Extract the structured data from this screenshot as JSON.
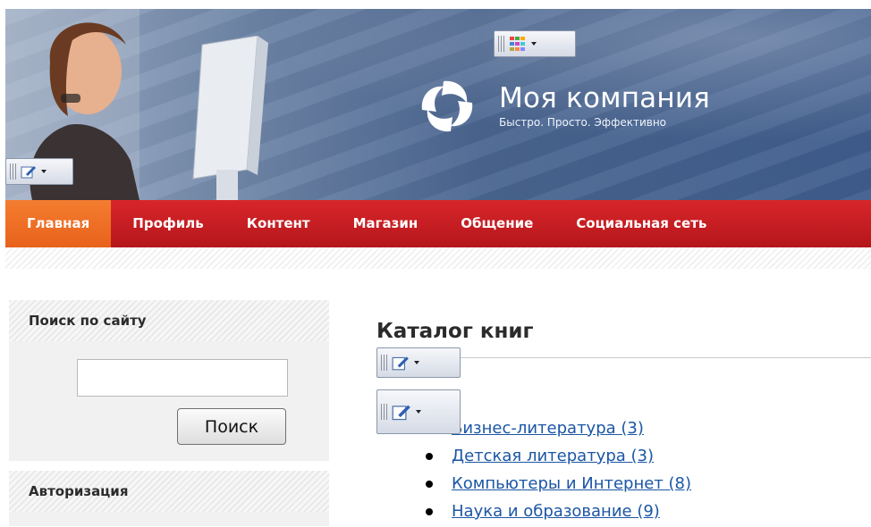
{
  "header": {
    "company_name": "Моя компания",
    "slogan": "Быстро. Просто. Эффективно"
  },
  "nav": {
    "items": [
      "Главная",
      "Профиль",
      "Контент",
      "Магазин",
      "Общение",
      "Социальная сеть"
    ],
    "active_index": 0
  },
  "sidebar": {
    "search_title": "Поиск по сайту",
    "search_input_value": "",
    "search_button": "Поиск",
    "auth_title": "Авторизация"
  },
  "main": {
    "title": "Каталог книг",
    "categories": [
      {
        "label": "Бизнес-литература (3)"
      },
      {
        "label": "Детская литература (3)"
      },
      {
        "label": "Компьютеры и Интернет (8)"
      },
      {
        "label": "Наука и образование (9)"
      }
    ]
  },
  "colors": {
    "nav_red": "#c91d22",
    "nav_active_orange": "#f07028",
    "link_blue": "#1b56a5"
  }
}
